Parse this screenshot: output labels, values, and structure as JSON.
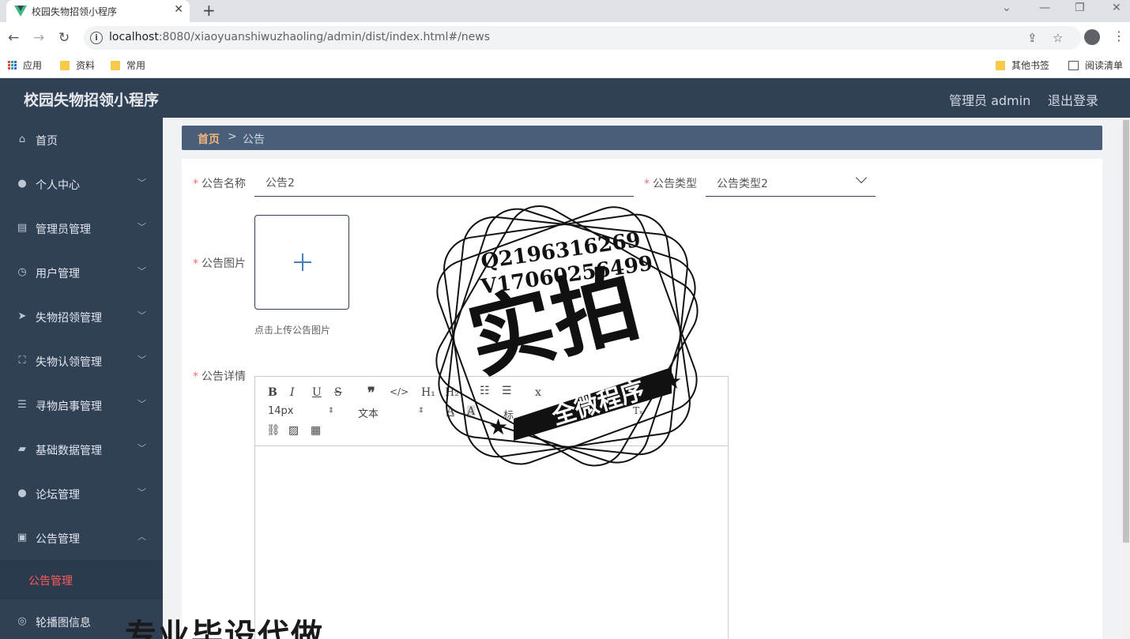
{
  "browser": {
    "tab_title": "校园失物招领小程序",
    "tab_close": "✕",
    "new_tab": "+",
    "url_host": "localhost",
    "url_rest": ":8080/xiaoyuanshiwuzhaoling/admin/dist/index.html#/news",
    "bookmarks": {
      "apps": "应用",
      "folder1": "资料",
      "folder2": "常用",
      "other": "其他书签",
      "reading_list": "阅读清单"
    }
  },
  "header": {
    "title": "校园失物招领小程序",
    "admin_label": "管理员 admin",
    "logout": "退出登录"
  },
  "sidebar": {
    "items": [
      {
        "label": "首页",
        "icon": "home-icon"
      },
      {
        "label": "个人中心",
        "icon": "user-icon"
      },
      {
        "label": "管理员管理",
        "icon": "clipboard-icon"
      },
      {
        "label": "用户管理",
        "icon": "clock-icon"
      },
      {
        "label": "失物招领管理",
        "icon": "send-icon"
      },
      {
        "label": "失物认领管理",
        "icon": "fullscreen-icon"
      },
      {
        "label": "寻物启事管理",
        "icon": "sliders-icon"
      },
      {
        "label": "基础数据管理",
        "icon": "ticket-icon"
      },
      {
        "label": "论坛管理",
        "icon": "user-icon"
      },
      {
        "label": "公告管理",
        "icon": "clipboard-check-icon"
      }
    ],
    "active_submenu": "公告管理",
    "next_item": "轮播图信息"
  },
  "breadcrumb": {
    "home": "首页",
    "separator": ">",
    "current": "公告"
  },
  "form": {
    "name_label": "公告名称",
    "name_value": "公告2",
    "type_label": "公告类型",
    "type_value": "公告类型2",
    "image_label": "公告图片",
    "upload_tip": "点击上传公告图片",
    "detail_label": "公告详情",
    "required_mark": "*"
  },
  "editor": {
    "font_size": "14px",
    "font_style": "文本",
    "heading": "标"
  },
  "overlay": {
    "stamp_line1": "Q2196316269",
    "stamp_line2": "V17060256499",
    "stamp_big": "实拍",
    "stamp_banner": "全微程序",
    "watermark": "专业毕设代做"
  }
}
